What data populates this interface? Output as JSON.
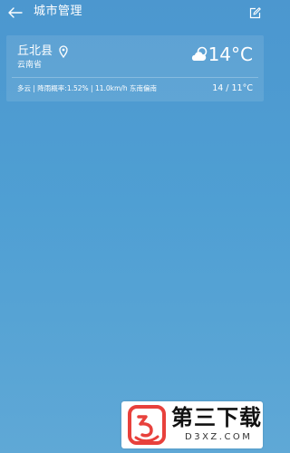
{
  "header": {
    "title": "城市管理",
    "back_icon": "back-arrow-icon",
    "edit_icon": "edit-icon"
  },
  "city_card": {
    "city": "丘北县",
    "province": "云南省",
    "location_icon": "location-pin-icon",
    "weather_icon": "partly-cloudy-icon",
    "current_temp": "14°C",
    "details": "多云 | 降雨概率:1.52% | 11.0km/h 东南偏南",
    "temp_range": "14 / 11°C"
  },
  "watermark": {
    "brand": "第三下载",
    "domain": "D3XZ.COM",
    "logo_icon": "d3xz-logo-icon"
  },
  "colors": {
    "background_top": "#4c97cf",
    "background_bottom": "#5fa8d6",
    "text": "#ffffff",
    "logo_red": "#e8413c"
  }
}
